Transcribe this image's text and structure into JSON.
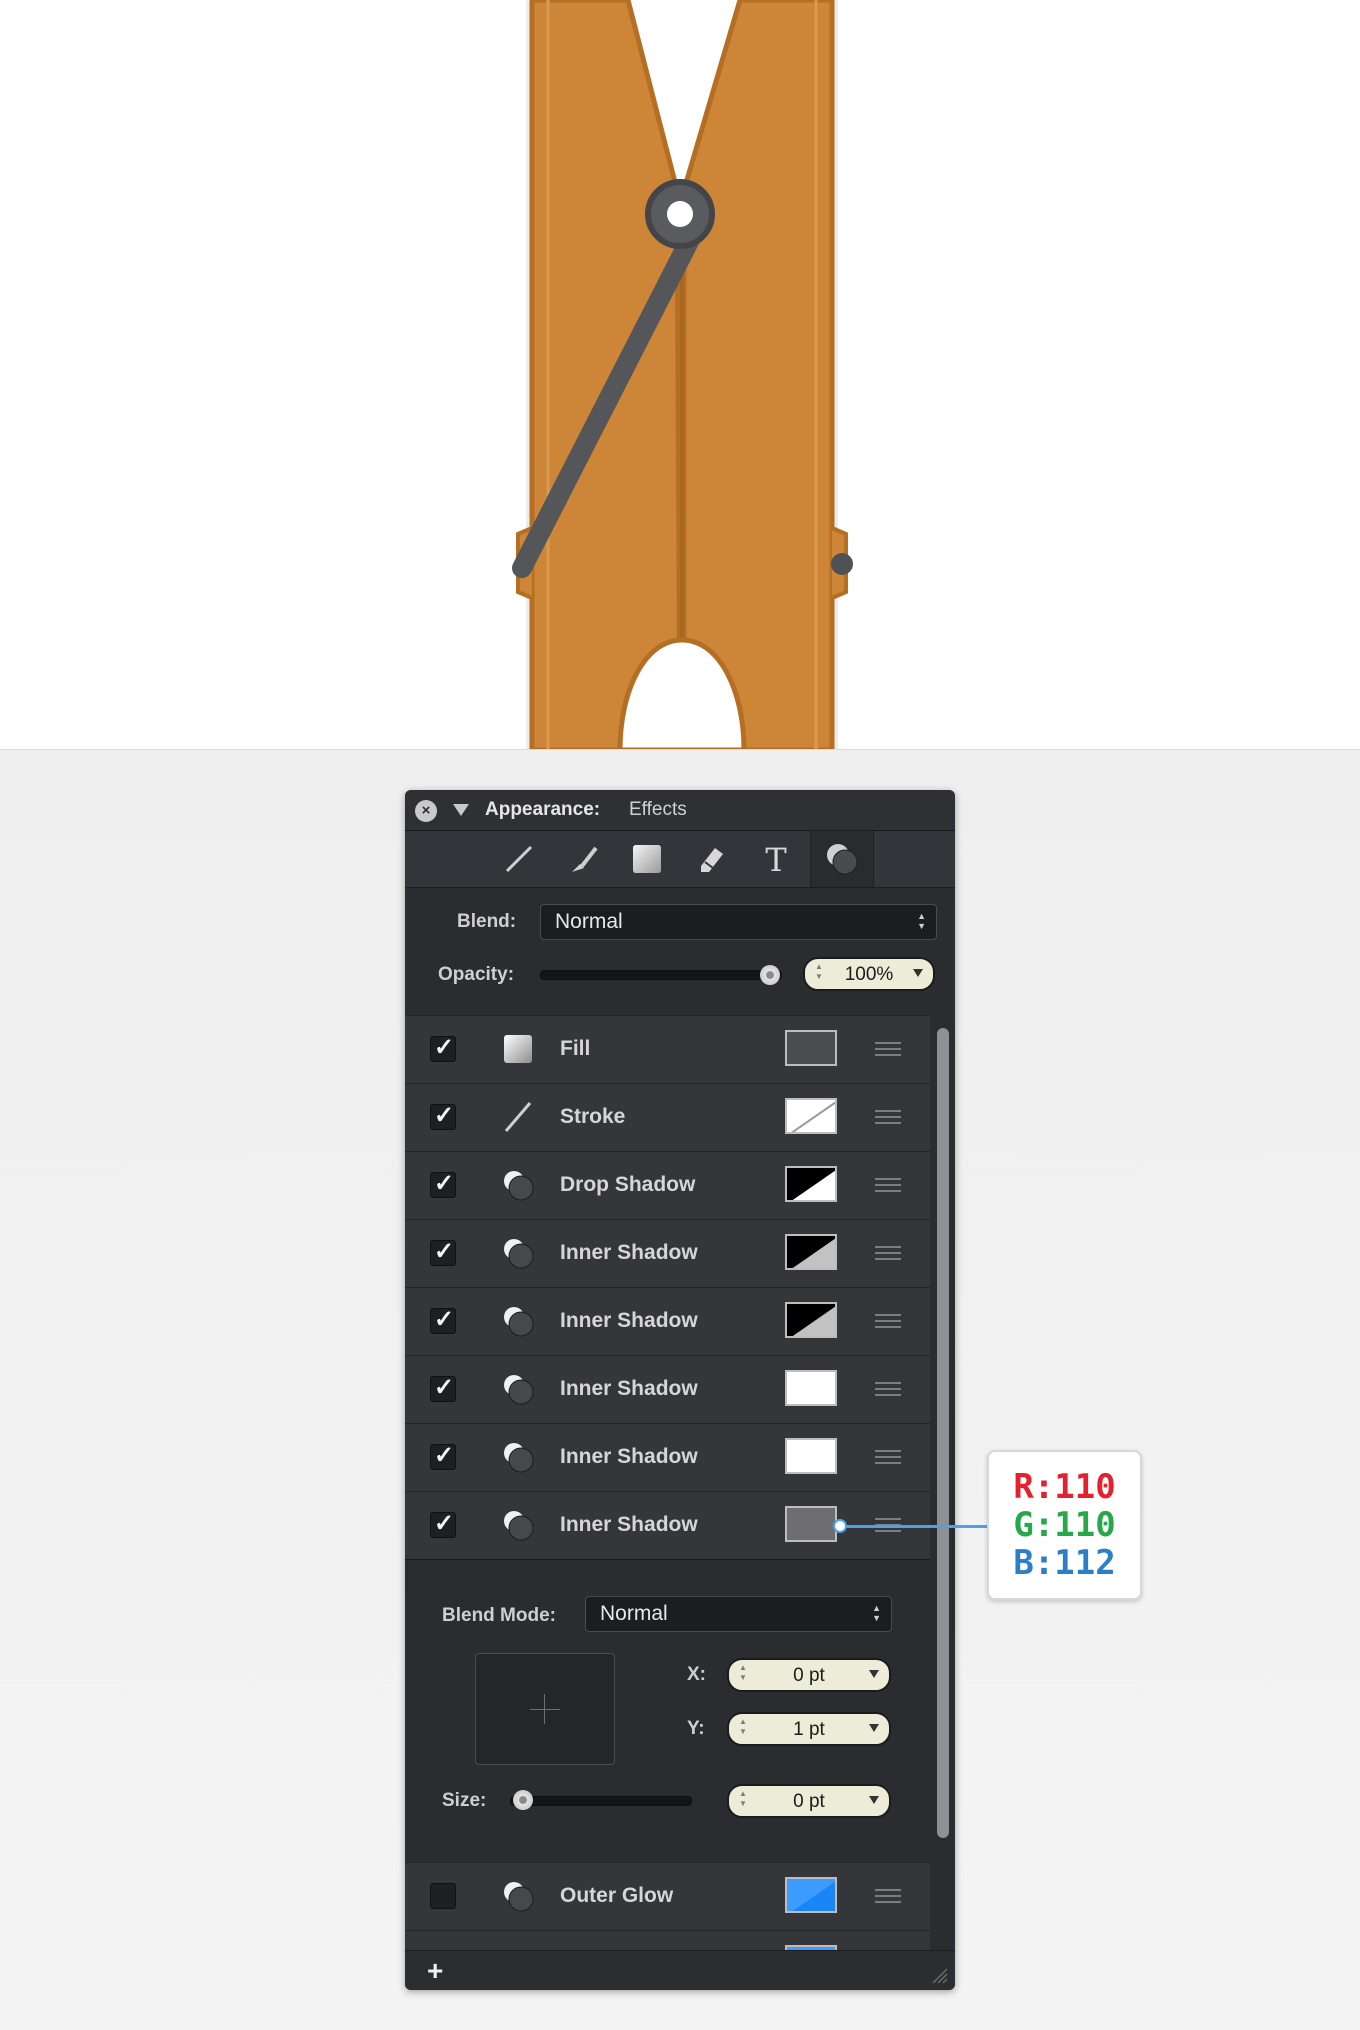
{
  "panel": {
    "title": "Appearance:",
    "subtitle": "Effects",
    "close_icon": "×",
    "tools": [
      "stroke-tool-icon",
      "brush-tool-icon",
      "fill-tool-icon",
      "eraser-tool-icon",
      "text-tool-icon",
      "effects-tool-icon"
    ],
    "blend_label": "Blend:",
    "blend_value": "Normal",
    "opacity_label": "Opacity:",
    "opacity_value": "100%",
    "opacity_level": 1.0
  },
  "effects": [
    {
      "name": "Fill",
      "enabled": true,
      "icon": "fill-icon",
      "swatch": "#4b4c4f"
    },
    {
      "name": "Stroke",
      "enabled": true,
      "icon": "stroke-icon",
      "swatch": "none"
    },
    {
      "name": "Drop Shadow",
      "enabled": true,
      "icon": "shadow-icon",
      "swatch": "black-white"
    },
    {
      "name": "Inner Shadow",
      "enabled": true,
      "icon": "shadow-icon",
      "swatch": "black-gray"
    },
    {
      "name": "Inner Shadow",
      "enabled": true,
      "icon": "shadow-icon",
      "swatch": "black-gray"
    },
    {
      "name": "Inner Shadow",
      "enabled": true,
      "icon": "shadow-icon",
      "swatch": "#ffffff"
    },
    {
      "name": "Inner Shadow",
      "enabled": true,
      "icon": "shadow-icon",
      "swatch": "#ffffff"
    },
    {
      "name": "Inner Shadow",
      "enabled": true,
      "icon": "shadow-icon",
      "swatch": "#6e6e70"
    }
  ],
  "details": {
    "blend_mode_label": "Blend Mode:",
    "blend_mode_value": "Normal",
    "x_label": "X:",
    "x_value": "0 pt",
    "y_label": "Y:",
    "y_value": "1 pt",
    "size_label": "Size:",
    "size_value": "0 pt"
  },
  "disabled_effects": [
    {
      "name": "Outer Glow",
      "enabled": false,
      "icon": "shadow-icon",
      "swatch": "#1a86f5"
    }
  ],
  "bottom": {
    "add_label": "+"
  },
  "color_callout": {
    "r": "R:110",
    "g": "G:110",
    "b": "B:112"
  }
}
